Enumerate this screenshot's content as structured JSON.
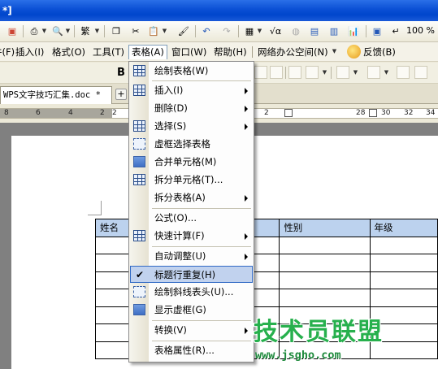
{
  "window": {
    "title": "*]"
  },
  "toolbar": {
    "zoom": "100 %"
  },
  "menubar": {
    "items": [
      {
        "label": "件(F)"
      },
      {
        "label": "插入(I)"
      },
      {
        "label": "格式(O)"
      },
      {
        "label": "工具(T)"
      },
      {
        "label": "表格(A)"
      },
      {
        "label": "窗口(W)"
      },
      {
        "label": "帮助(H)"
      },
      {
        "label": "网络办公空间(N)"
      },
      {
        "label": "反馈(B)"
      }
    ]
  },
  "format_bar": {
    "bold": "B"
  },
  "tabs": {
    "doc": "WPS文字技巧汇集.doc *",
    "add": "+"
  },
  "ruler": {
    "left_numbers": [
      "8",
      "6",
      "4",
      "2"
    ],
    "right_numbers": [
      "2",
      "28",
      "30",
      "32",
      "34"
    ],
    "first": "2"
  },
  "table_menu": {
    "items": [
      {
        "label": "绘制表格(W)",
        "icon": "draw-table-icon",
        "submenu": false
      },
      {
        "label": "插入(I)",
        "icon": "insert-table-icon",
        "submenu": true
      },
      {
        "label": "删除(D)",
        "icon": "",
        "submenu": true
      },
      {
        "label": "选择(S)",
        "icon": "select-table-icon",
        "submenu": true
      },
      {
        "label": "虚框选择表格",
        "icon": "dashed-select-icon",
        "submenu": false
      },
      {
        "label": "合并单元格(M)",
        "icon": "merge-cells-icon",
        "submenu": false
      },
      {
        "label": "拆分单元格(T)...",
        "icon": "split-cells-icon",
        "submenu": false
      },
      {
        "label": "拆分表格(A)",
        "icon": "",
        "submenu": true
      },
      {
        "label": "公式(O)...",
        "icon": "",
        "submenu": false
      },
      {
        "label": "快速计算(F)",
        "icon": "quick-calc-icon",
        "submenu": true
      },
      {
        "label": "自动调整(U)",
        "icon": "",
        "submenu": true
      },
      {
        "label": "标题行重复(H)",
        "icon": "check-icon",
        "submenu": false
      },
      {
        "label": "绘制斜线表头(U)...",
        "icon": "diagonal-header-icon",
        "submenu": false
      },
      {
        "label": "显示虚框(G)",
        "icon": "show-gridlines-icon",
        "submenu": false
      },
      {
        "label": "转换(V)",
        "icon": "",
        "submenu": true
      },
      {
        "label": "表格属性(R)...",
        "icon": "",
        "submenu": false
      }
    ]
  },
  "document_table": {
    "headers": [
      "姓名",
      "",
      "性别",
      "年级"
    ],
    "empty_rows": 7
  },
  "watermark": {
    "title": "技术员联盟",
    "url": "www.jsgho.com"
  },
  "colors": {
    "titlebar": "#0a4fd4",
    "highlight": "#c1d2ee",
    "table_header": "#bcd2ee",
    "watermark": "#27b04d"
  }
}
